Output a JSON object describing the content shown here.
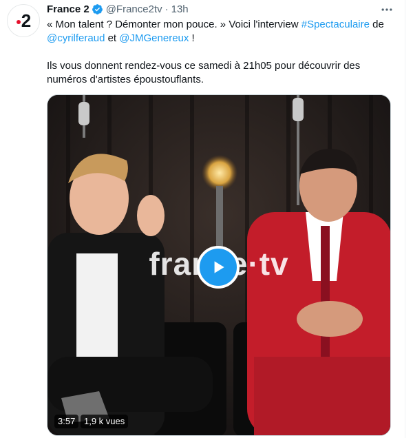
{
  "tweet": {
    "author_name": "France 2",
    "author_handle": "@France2tv",
    "separator": "·",
    "time": "13h",
    "avatar_text": "2",
    "icons": {
      "verified": "verified-badge-icon",
      "more": "more-horizontal-icon",
      "play": "play-icon"
    },
    "paragraph1": {
      "part1": "« Mon talent ? Démonter mon pouce. » Voici l'interview ",
      "hashtag": "#Spectaculaire",
      "part2": " de",
      "mention1": "@cyrilferaud",
      "part3": " et ",
      "mention2": "@JMGenereux",
      "part4": " !"
    },
    "paragraph2": "Ils vous donnent rendez-vous ce samedi à 21h05 pour découvrir des numéros d'artistes époustouflants."
  },
  "video": {
    "watermark": "france·tv",
    "duration": "3:57",
    "views": "1,9 k vues"
  },
  "colors": {
    "link": "#1d9bf0",
    "brand_red": "#e5102c",
    "secondary_text": "#536471",
    "text": "#0f1419"
  }
}
